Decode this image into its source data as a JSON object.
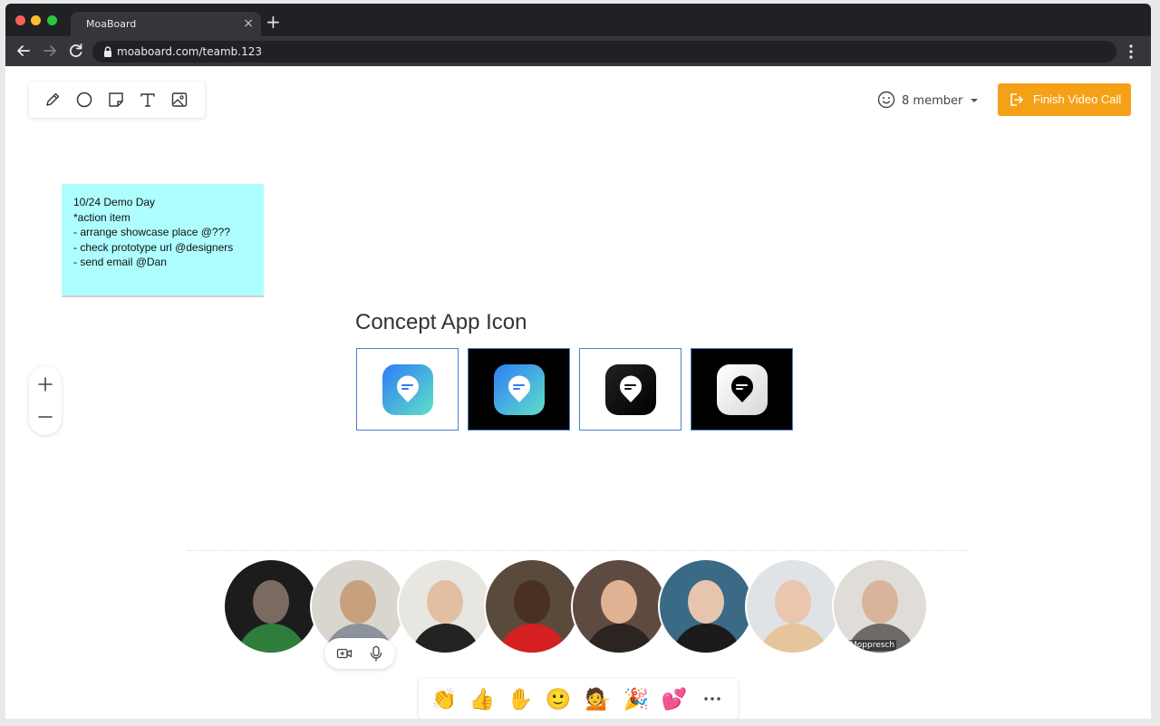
{
  "browser": {
    "tab_title": "MoaBoard",
    "tab_close": "×",
    "new_tab": "+",
    "url": "moaboard.com/teamb.123"
  },
  "header": {
    "members_label": "8 member",
    "finish_label": "Finish Video Call"
  },
  "toolbar": {
    "tools": [
      "pencil-icon",
      "circle-icon",
      "sticky-note-icon",
      "text-icon",
      "image-icon"
    ]
  },
  "sticky_note": {
    "lines": [
      "10/24 Demo Day",
      "",
      "*action item",
      "- arrange showcase place @???",
      "- check prototype url @designers",
      "- send email @Dan"
    ]
  },
  "board": {
    "section_title": "Concept App Icon"
  },
  "participants": [
    {
      "tag": ""
    },
    {
      "tag": ""
    },
    {
      "tag": ""
    },
    {
      "tag": ""
    },
    {
      "tag": ""
    },
    {
      "tag": ""
    },
    {
      "tag": ""
    },
    {
      "tag": "Moppresch"
    }
  ],
  "reactions": [
    {
      "name": "clap-emoji",
      "glyph": "👏"
    },
    {
      "name": "thumbs-up-emoji",
      "glyph": "👍"
    },
    {
      "name": "raised-hand-emoji",
      "glyph": "✋"
    },
    {
      "name": "smile-emoji",
      "glyph": "🙂"
    },
    {
      "name": "person-emoji",
      "glyph": "💁"
    },
    {
      "name": "party-emoji",
      "glyph": "🎉"
    },
    {
      "name": "hearts-emoji",
      "glyph": "💕"
    }
  ],
  "colors": {
    "accent": "#f5a117",
    "sticky": "#aefdff",
    "frame_border": "#4a7fd0"
  }
}
